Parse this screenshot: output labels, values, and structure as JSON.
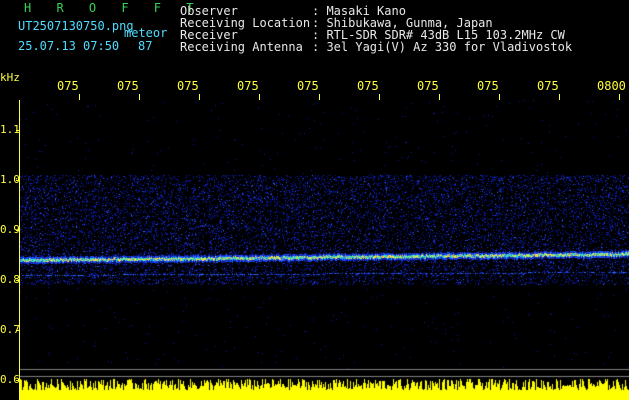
{
  "header": {
    "app_name": "H R O F F T",
    "filename": "UT2507130750.png",
    "meteor_label": "meteor",
    "datetime": "25.07.13 07:50",
    "count": "87",
    "fields": [
      {
        "label": "Observer",
        "value": ": Masaki Kano"
      },
      {
        "label": "Receiving Location",
        "value": ": Shibukawa, Gunma, Japan"
      },
      {
        "label": "Receiver",
        "value": ": RTL-SDR SDR# 43dB L15 103.2MHz CW"
      },
      {
        "label": "Receiving Antenna",
        "value": ": 3el Yagi(V) Az 330 for Vladivostok"
      }
    ]
  },
  "axis": {
    "unit": "kHz",
    "y_ticks": [
      "1.1",
      "1.0",
      "0.9",
      "0.8",
      "0.7",
      "0.6"
    ],
    "x_ticks": [
      "075",
      "075",
      "075",
      "075",
      "075",
      "075",
      "075",
      "075",
      "075",
      "0800"
    ]
  },
  "spectrogram": {
    "freq_range_khz": [
      0.6,
      1.15
    ],
    "noise_band_khz": [
      0.79,
      1.01
    ],
    "carrier_khz": 0.84,
    "secondary_khz": 0.81,
    "colors": {
      "background": "#000000",
      "noise": "#1a2fd0",
      "carrier_hot": "#ffe040",
      "carrier_mid": "#30e0c0",
      "signal_bar": "#ffff00",
      "axis": "#ffff3a"
    }
  }
}
